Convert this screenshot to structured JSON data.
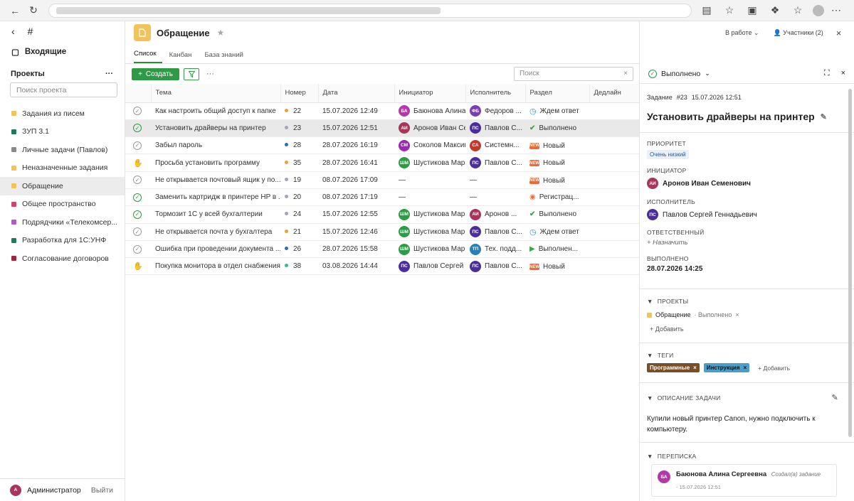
{
  "sidebar": {
    "inbox": "Входящие",
    "projects_title": "Проекты",
    "search_placeholder": "Поиск проекта",
    "items": [
      {
        "label": "Задания из писем",
        "color": "#f2c35a"
      },
      {
        "label": "ЗУП 3.1",
        "color": "#1f7a5a"
      },
      {
        "label": "Личные задачи (Павлов)",
        "color": "#8a8a8a"
      },
      {
        "label": "Неназначенные задания",
        "color": "#f2c35a"
      },
      {
        "label": "Обращение",
        "color": "#f2c35a"
      },
      {
        "label": "Общее пространство",
        "color": "#d0436b"
      },
      {
        "label": "Подрядчики «Телекомсер...",
        "color": "#b05ac8"
      },
      {
        "label": "Разработка для 1С:УНФ",
        "color": "#1f7a5a"
      },
      {
        "label": "Согласование договоров",
        "color": "#a3253a"
      }
    ],
    "user_initial": "А",
    "user": "Администратор",
    "logout": "Выйти"
  },
  "main": {
    "title": "Обращение",
    "tabs": [
      "Список",
      "Канбан",
      "База знаний"
    ],
    "create": "Создать",
    "search_placeholder": "Поиск",
    "columns": [
      "Тема",
      "Номер",
      "Дата",
      "Инициатор",
      "Исполнитель",
      "Раздел",
      "Дедлайн"
    ],
    "rows": [
      {
        "status": "open",
        "topic": "Как настроить общий доступ к папке",
        "dot": "#e8a03a",
        "num": "22",
        "date": "15.07.2026 12:49",
        "ini": "БА",
        "ini_color": "#b23aa8",
        "ini_name": "Баюнова Алина С",
        "exe": "ФБ",
        "exe_color": "#7a3fb0",
        "exe_name": "Федоров ...",
        "sec_icon": "clock",
        "section": "Ждем ответ"
      },
      {
        "status": "done",
        "topic": "Установить драйверы на принтер",
        "dot": "#a0a6b4",
        "num": "23",
        "date": "15.07.2026 12:51",
        "ini": "АИ",
        "ini_color": "#a8345a",
        "ini_name": "Аронов Иван Сем",
        "exe": "ПС",
        "exe_color": "#4b2e9a",
        "exe_name": "Павлов С...",
        "sec_icon": "check",
        "section": "Выполнено"
      },
      {
        "status": "open",
        "topic": "Забыл пароль",
        "dot": "#2d6db5",
        "num": "28",
        "date": "28.07.2026 16:19",
        "ini": "СМ",
        "ini_color": "#9b2ab0",
        "ini_name": "Соколов Максим",
        "exe": "СА",
        "exe_color": "#c0392b",
        "exe_name": "Системн...",
        "sec_icon": "new",
        "section": "Новый"
      },
      {
        "status": "hand",
        "topic": "Просьба установить программу",
        "dot": "#e8a03a",
        "num": "35",
        "date": "28.07.2026 16:41",
        "ini": "ШМ",
        "ini_color": "#2e9a46",
        "ini_name": "Шустикова Марин",
        "exe": "ПС",
        "exe_color": "#4b2e9a",
        "exe_name": "Павлов С...",
        "sec_icon": "new",
        "section": "Новый"
      },
      {
        "status": "open",
        "topic": "Не открывается почтовый ящик у по...",
        "dot": "#a0a6b4",
        "num": "19",
        "date": "08.07.2026 17:09",
        "ini": "",
        "ini_color": "",
        "ini_name": "—",
        "exe": "",
        "exe_color": "",
        "exe_name": "—",
        "sec_icon": "new",
        "section": "Новый"
      },
      {
        "status": "done",
        "topic": "Заменить картридж в принтере HP в ...",
        "dot": "#a0a6b4",
        "num": "20",
        "date": "08.07.2026 17:19",
        "ini": "",
        "ini_color": "",
        "ini_name": "—",
        "exe": "",
        "exe_color": "",
        "exe_name": "—",
        "sec_icon": "reg",
        "section": "Регистрац..."
      },
      {
        "status": "done",
        "topic": "Тормозит 1С у всей бухгалтерии",
        "dot": "#a0a6b4",
        "num": "24",
        "date": "15.07.2026 12:55",
        "ini": "ШМ",
        "ini_color": "#2e9a46",
        "ini_name": "Шустикова Марин",
        "exe": "АИ",
        "exe_color": "#a8345a",
        "exe_name": "Аронов ...",
        "sec_icon": "check",
        "section": "Выполнено"
      },
      {
        "status": "open",
        "topic": "Не открывается почта у бухгалтера",
        "dot": "#e8a03a",
        "num": "21",
        "date": "15.07.2026 12:46",
        "ini": "ШМ",
        "ini_color": "#2e9a46",
        "ini_name": "Шустикова Марин",
        "exe": "ПС",
        "exe_color": "#4b2e9a",
        "exe_name": "Павлов С...",
        "sec_icon": "clock",
        "section": "Ждем ответ"
      },
      {
        "status": "open",
        "topic": "Ошибка при проведении документа ...",
        "dot": "#2d6db5",
        "num": "26",
        "date": "28.07.2026 15:58",
        "ini": "ШМ",
        "ini_color": "#2e9a46",
        "ini_name": "Шустикова Марин",
        "exe": "ТП",
        "exe_color": "#2a7fb8",
        "exe_name": "Тех. подд...",
        "sec_icon": "play",
        "section": "Выполнен..."
      },
      {
        "status": "hand",
        "topic": "Покупка монитора в отдел снабжения",
        "dot": "#35b98a",
        "num": "38",
        "date": "03.08.2026 14:44",
        "ini": "ПС",
        "ini_color": "#4b2e9a",
        "ini_name": "Павлов Сергей Ге",
        "exe": "ПС",
        "exe_color": "#4b2e9a",
        "exe_name": "Павлов С...",
        "sec_icon": "new",
        "section": "Новый"
      }
    ]
  },
  "header": {
    "status": "В работе",
    "members": "Участники (2)"
  },
  "panel": {
    "status": "Выполнено",
    "task_label": "Задание",
    "task_num": "#23",
    "task_date": "15.07.2026 12:51",
    "title": "Установить драйверы на принтер",
    "priority_label": "ПРИОРИТЕТ",
    "priority": "Очень низкий",
    "initiator_label": "ИНИЦИАТОР",
    "initiator_av": "АИ",
    "initiator": "Аронов Иван Семенович",
    "executor_label": "ИСПОЛНИТЕЛЬ",
    "executor_av": "ПС",
    "executor": "Павлов Сергей Геннадьевич",
    "responsible_label": "ОТВЕТСТВЕННЫЙ",
    "assign": "+ Назначить",
    "done_label": "ВЫПОЛНЕНО",
    "done_date": "28.07.2026 14:25",
    "projects_label": "ПРОЕКТЫ",
    "project": "Обращение",
    "project_status": "· Выполнено",
    "add": "+ Добавить",
    "tags_label": "ТЕГИ",
    "tag1": "Программные",
    "tag2": "Инструкция",
    "tag_add": "+ Добавить",
    "desc_label": "ОПИСАНИЕ ЗАДАЧИ",
    "desc": "Купили новый принтер Canon, нужно подключить к компьютеру.",
    "chat_label": "ПЕРЕПИСКА",
    "chat_av": "БА",
    "chat_author": "Баюнова Алина Сергеевна",
    "chat_action": "Создал(а) задание",
    "chat_date": "- 15.07.2026 12:51"
  }
}
